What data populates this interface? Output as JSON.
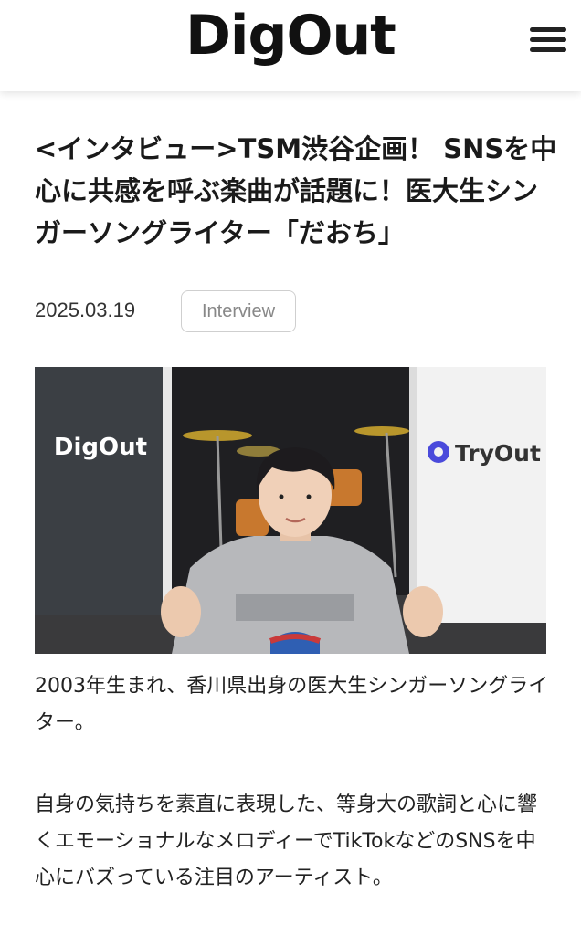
{
  "header": {
    "logo": "DigOut"
  },
  "article": {
    "title": "<インタビュー>TSM渋谷企画！ SNSを中心に共感を呼ぶ楽曲が話題に！医大生シンガーソングライター「だおち」",
    "date": "2025.03.19",
    "category": "Interview",
    "image": {
      "left_banner": "DigOut",
      "right_banner": "TryOut"
    },
    "caption": "2003年生まれ、香川県出身の医大生シンガーソングライター。",
    "paragraph": "自身の気持ちを素直に表現した、等身大の歌詞と心に響くエモーショナルなメロディーでTikTokなどのSNSを中心にバズっている注目のアーティスト。"
  },
  "colors": {
    "text": "#1a1a1a",
    "tag_border": "#cfcfcf",
    "tag_text": "#888888",
    "tryout_brand": "#4a4adb"
  }
}
